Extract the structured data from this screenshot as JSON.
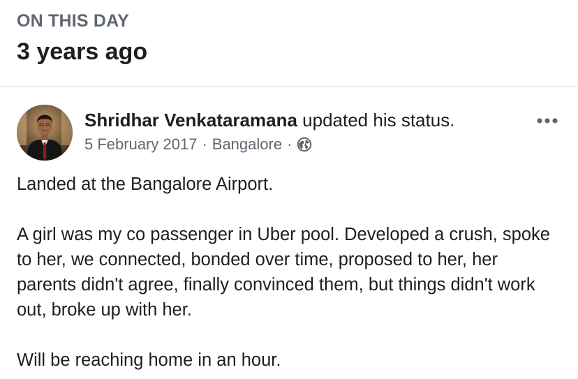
{
  "memory": {
    "label": "ON THIS DAY",
    "title": "3 years ago"
  },
  "post": {
    "author": "Shridhar Venkataramana",
    "action": "updated his status.",
    "date": "5 February 2017",
    "separator": "·",
    "location": "Bangalore",
    "privacy_icon": "globe-icon",
    "more_icon": "more-options-icon",
    "paragraphs": [
      "Landed at the Bangalore Airport.",
      "A girl was my co passenger in Uber pool. Developed a crush, spoke to her, we connected, bonded over time, proposed to her, her parents didn't agree, finally convinced them, but things didn't work out, broke up with her.",
      "Will be reaching home in an hour."
    ]
  },
  "colors": {
    "primary_text": "#1c1e21",
    "secondary_text": "#606770",
    "divider": "#dadde1"
  }
}
